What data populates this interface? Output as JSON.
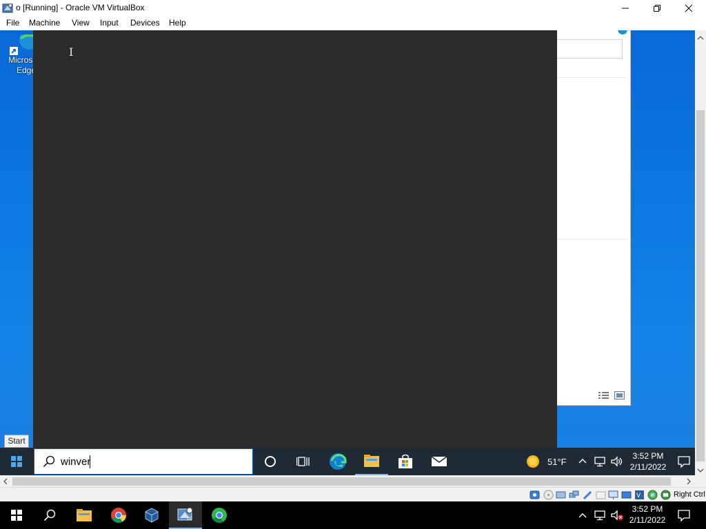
{
  "window": {
    "title": "o [Running] - Oracle VM VirtualBox",
    "minimize_label": "minimize",
    "restore_label": "restore",
    "close_label": "close"
  },
  "menu": [
    "File",
    "Machine",
    "View",
    "Input",
    "Devices",
    "Help"
  ],
  "guest": {
    "desktop_icon_label_line1": "Micros",
    "desktop_icon_label_line2": "Edge",
    "start_tooltip": "Start",
    "search_value": "winver",
    "weather": "51°F",
    "clock_time": "3:52 PM",
    "clock_date": "2/11/2022",
    "taskbar_icons": [
      "cortana-icon",
      "task-view-icon",
      "edge-icon",
      "file-explorer-icon",
      "store-icon",
      "mail-icon"
    ]
  },
  "statusbar": {
    "host_key": "Right Ctrl"
  },
  "host_taskbar": {
    "clock_time": "3:52 PM",
    "clock_date": "2/11/2022",
    "icons": [
      "windows-start-icon",
      "search-icon",
      "file-explorer-icon",
      "chrome-icon",
      "virtualbox-icon",
      "virtualbox-vm-icon",
      "chrome-beta-icon"
    ]
  },
  "colors": {
    "guest_desktop": "#0078d7",
    "search_panel": "#2b2b2b",
    "guest_taskbar": "#1f2a35",
    "host_taskbar": "#000000"
  }
}
